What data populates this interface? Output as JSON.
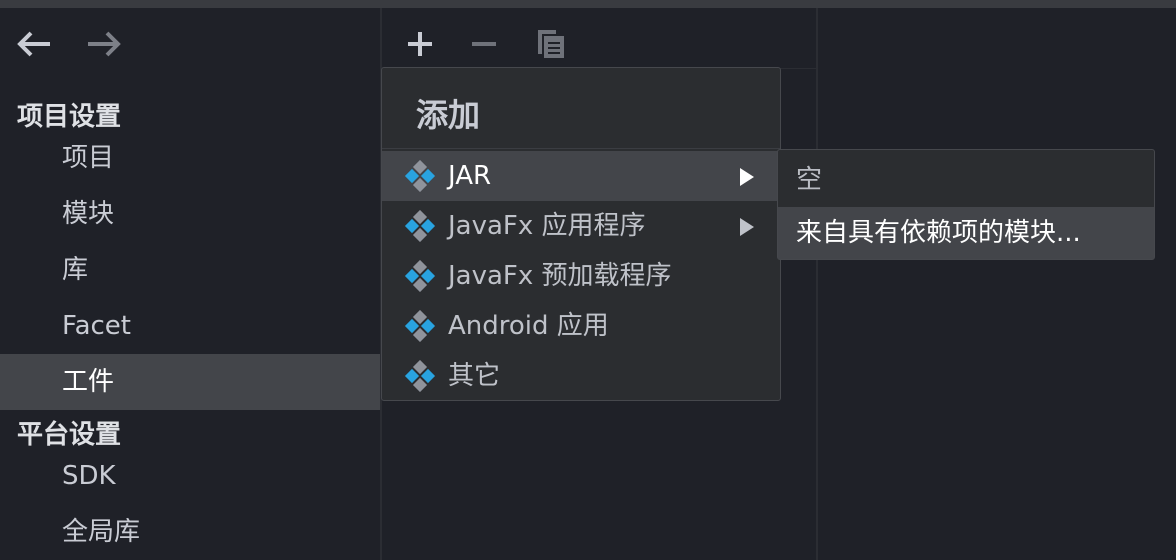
{
  "nav": {
    "back_icon": "arrow-left-icon",
    "forward_icon": "arrow-right-icon"
  },
  "sidebar": {
    "project_settings_title": "项目设置",
    "project_items": [
      "项目",
      "模块",
      "库",
      "Facet",
      "工件"
    ],
    "selected_item": "工件",
    "platform_settings_title": "平台设置",
    "platform_items": [
      "SDK",
      "全局库"
    ]
  },
  "toolbar": {
    "icons": [
      "plus-icon",
      "minus-icon",
      "copy-icon"
    ]
  },
  "popup": {
    "title": "添加",
    "items": [
      {
        "label": "JAR",
        "icon": "artifact-diamond-icon",
        "has_submenu": true,
        "active": true
      },
      {
        "label": "JavaFx 应用程序",
        "icon": "artifact-diamond-icon",
        "has_submenu": true
      },
      {
        "label": "JavaFx 预加载程序",
        "icon": "artifact-diamond-icon"
      },
      {
        "label": "Android 应用",
        "icon": "artifact-diamond-icon"
      },
      {
        "label": "其它",
        "icon": "artifact-diamond-icon"
      }
    ]
  },
  "submenu": {
    "items": [
      {
        "label": "空"
      },
      {
        "label": "来自具有依赖项的模块...",
        "active": true
      }
    ]
  },
  "colors": {
    "background": "#1f2128",
    "selection": "#43454a",
    "menu_bg": "#2b2d30",
    "icon_blue": "#29a3e0"
  }
}
